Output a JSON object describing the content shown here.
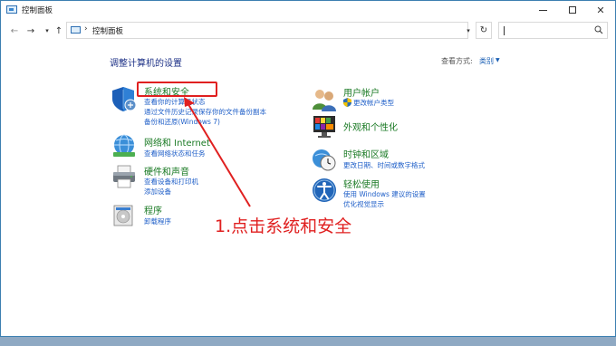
{
  "window": {
    "title": "控制面板",
    "minimize_glyph": "",
    "maximize_glyph": "",
    "close_glyph": "✕"
  },
  "nav": {
    "back": "←",
    "forward": "→",
    "recent": "▾",
    "up": "↑",
    "address_separator": "›",
    "address_path": "控制面板",
    "address_dropdown": "▾",
    "refresh": "↻"
  },
  "search": {
    "placeholder": ""
  },
  "main": {
    "title": "调整计算机的设置",
    "view_by_label": "查看方式:",
    "view_by_value": "类别",
    "view_by_arrow": "▼"
  },
  "categories": {
    "system_security": {
      "title": "系统和安全",
      "icon": "shield-icon",
      "links": [
        "查看你的计算机状态",
        "通过文件历史记录保存你的文件备份副本",
        "备份和还原(Windows 7)"
      ]
    },
    "network": {
      "title": "网络和 Internet",
      "icon": "network-globe-icon",
      "links": [
        "查看网络状态和任务"
      ]
    },
    "hardware": {
      "title": "硬件和声音",
      "icon": "printer-icon",
      "links": [
        "查看设备和打印机",
        "添加设备"
      ]
    },
    "programs": {
      "title": "程序",
      "icon": "programs-disk-icon",
      "links": [
        "卸载程序"
      ]
    },
    "user_accounts": {
      "title": "用户帐户",
      "icon": "users-icon",
      "links": [
        "更改帐户类型"
      ]
    },
    "appearance": {
      "title": "外观和个性化",
      "icon": "appearance-monitor-icon",
      "links": []
    },
    "clock_region": {
      "title": "时钟和区域",
      "icon": "clock-globe-icon",
      "links": [
        "更改日期、时间或数字格式"
      ]
    },
    "ease_access": {
      "title": "轻松使用",
      "icon": "ease-of-access-icon",
      "links": [
        "使用 Windows 建议的设置",
        "优化视觉显示"
      ]
    }
  },
  "annotation": {
    "text": "1.点击系统和安全"
  },
  "colors": {
    "category_title": "#1a7a24",
    "link": "#1f5fc8",
    "heading": "#1e3287",
    "annotation": "#e02020"
  }
}
